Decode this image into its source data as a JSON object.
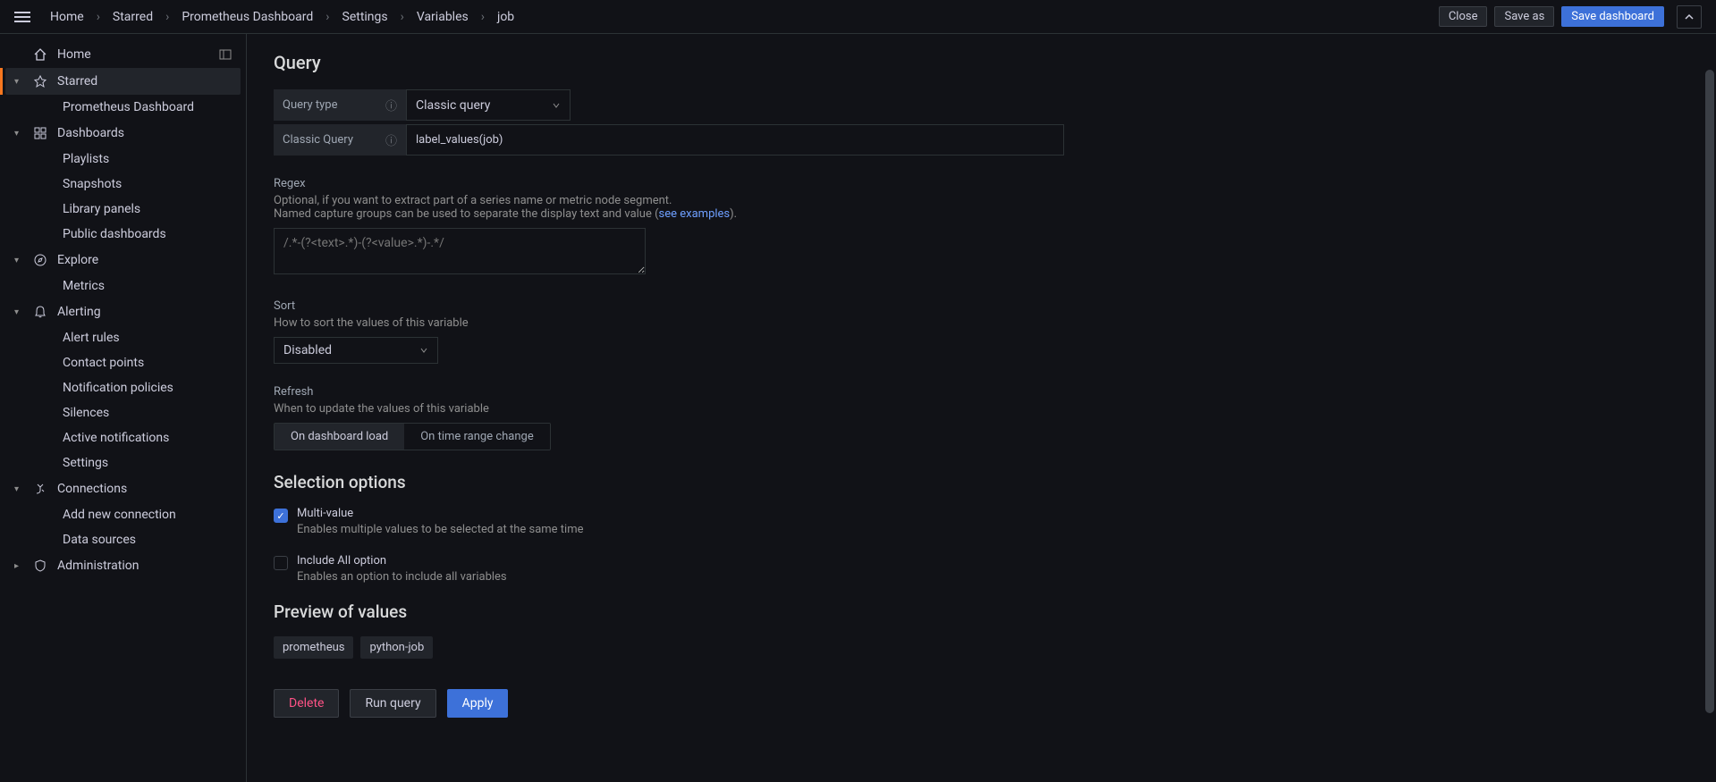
{
  "breadcrumb": {
    "items": [
      "Home",
      "Starred",
      "Prometheus Dashboard",
      "Settings",
      "Variables",
      "job"
    ]
  },
  "header_actions": {
    "close": "Close",
    "save_as": "Save as",
    "save_dashboard": "Save dashboard"
  },
  "sidebar": {
    "home": "Home",
    "starred": "Starred",
    "prometheus_dashboard": "Prometheus Dashboard",
    "dashboards": "Dashboards",
    "playlists": "Playlists",
    "snapshots": "Snapshots",
    "library_panels": "Library panels",
    "public_dashboards": "Public dashboards",
    "explore": "Explore",
    "metrics": "Metrics",
    "alerting": "Alerting",
    "alert_rules": "Alert rules",
    "contact_points": "Contact points",
    "notification_policies": "Notification policies",
    "silences": "Silences",
    "active_notifications": "Active notifications",
    "settings": "Settings",
    "connections": "Connections",
    "add_new_connection": "Add new connection",
    "data_sources": "Data sources",
    "administration": "Administration"
  },
  "query": {
    "title": "Query",
    "query_type_label": "Query type",
    "query_type_value": "Classic query",
    "classic_query_label": "Classic Query",
    "classic_query_value": "label_values(job)"
  },
  "regex": {
    "label": "Regex",
    "help_line1": "Optional, if you want to extract part of a series name or metric node segment.",
    "help_line2_pre": "Named capture groups can be used to separate the display text and value (",
    "help_link": "see examples",
    "help_line2_post": ").",
    "placeholder": "/.*-(?<text>.*)-(?<value>.*)-.*/"
  },
  "sort": {
    "label": "Sort",
    "help": "How to sort the values of this variable",
    "value": "Disabled"
  },
  "refresh": {
    "label": "Refresh",
    "help": "When to update the values of this variable",
    "option1": "On dashboard load",
    "option2": "On time range change"
  },
  "selection": {
    "title": "Selection options",
    "multi_value_label": "Multi-value",
    "multi_value_help": "Enables multiple values to be selected at the same time",
    "include_all_label": "Include All option",
    "include_all_help": "Enables an option to include all variables"
  },
  "preview": {
    "title": "Preview of values",
    "badges": [
      "prometheus",
      "python-job"
    ]
  },
  "actions": {
    "delete": "Delete",
    "run_query": "Run query",
    "apply": "Apply"
  }
}
